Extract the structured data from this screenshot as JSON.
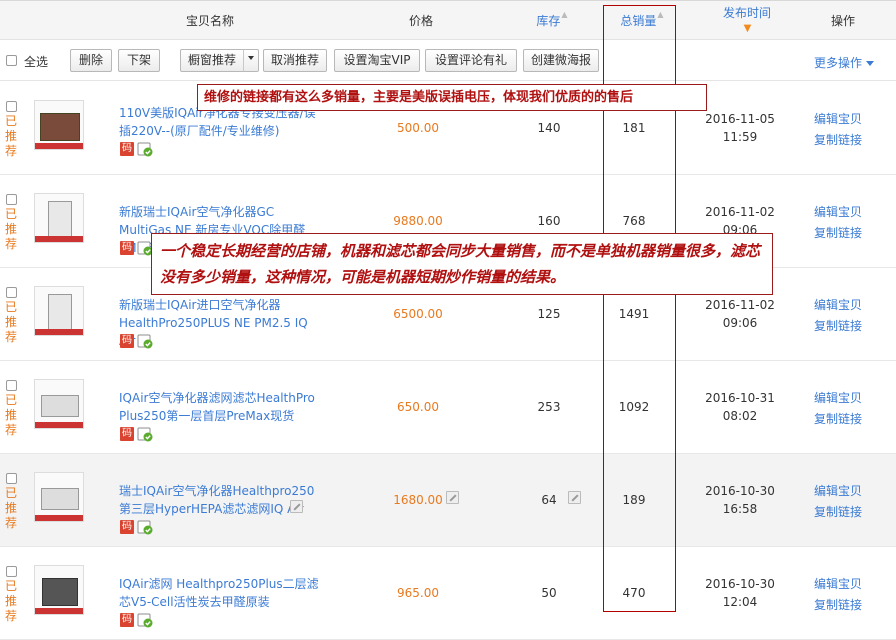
{
  "header": {
    "product_name": "宝贝名称",
    "price": "价格",
    "stock": "库存",
    "sold_total": "总销量",
    "publish_time": "发布时间",
    "actions": "操作"
  },
  "toolbar": {
    "select_all": "全选",
    "delete": "删除",
    "delist": "下架",
    "window_recommend": "橱窗推荐",
    "cancel_recommend": "取消推荐",
    "set_taobao_vip": "设置淘宝VIP",
    "set_review_gift": "设置评论有礼",
    "create_weihaibao": "创建微海报",
    "more_actions": "更多操作"
  },
  "row_labels": {
    "recommend": "已推荐",
    "badge_ma": "码",
    "edit": "编辑宝贝",
    "copy": "复制链接"
  },
  "rows": [
    {
      "title": "110V美版IQAir净化器专接变压器/误插220V--(原厂配件/专业维修)",
      "price": "500.00",
      "stock": "140",
      "sold": "181",
      "date": "2016-11-05",
      "time": "11:59",
      "thumb": "tool"
    },
    {
      "title": "新版瑞士IQAir空气净化器GC MultiGas NE 新房专业VOC除甲醛PM2.5",
      "price": "9880.00",
      "stock": "160",
      "sold": "768",
      "date": "2016-11-02",
      "time": "09:06",
      "thumb": "tower"
    },
    {
      "title": "新版瑞士IQAir进口空气净化器HealthPro250PLUS NE PM2.5 IQ Air",
      "price": "6500.00",
      "stock": "125",
      "sold": "1491",
      "date": "2016-11-02",
      "time": "09:06",
      "thumb": "tower"
    },
    {
      "title": "IQAir空气净化器滤网滤芯HealthPro Plus250第一层首层PreMax现货",
      "price": "650.00",
      "stock": "253",
      "sold": "1092",
      "date": "2016-10-31",
      "time": "08:02",
      "thumb": "box"
    },
    {
      "title": "瑞士IQAir空气净化器Healthpro250第三层HyperHEPA滤芯滤网IQ Air",
      "price": "1680.00",
      "stock": "64",
      "sold": "189",
      "date": "2016-10-30",
      "time": "16:58",
      "thumb": "box"
    },
    {
      "title": "IQAir滤网 Healthpro250Plus二层滤芯V5-Cell活性炭去甲醛原装",
      "price": "965.00",
      "stock": "50",
      "sold": "470",
      "date": "2016-10-30",
      "time": "12:04",
      "thumb": "dark"
    }
  ],
  "annotations": {
    "note1": "维修的链接都有这么多销量，主要是美版误插电压，体现我们优质的的售后",
    "note2": "一个稳定长期经营的店铺，机器和滤芯都会同步大量销售，而不是单独机器销量很多，滤芯没有多少销量，这种情况，可能是机器短期炒作销量的结果。"
  },
  "colors": {
    "link": "#3b7bd4",
    "price": "#e87a1f",
    "annotation": "#b01010"
  },
  "icons": {
    "sort_inactive": "sort-arrow-icon",
    "sort_active": "sort-desc-arrow-icon",
    "badge_ma": "qr-code-badge-icon",
    "badge_ok": "verified-check-icon",
    "edit": "pencil-icon"
  }
}
